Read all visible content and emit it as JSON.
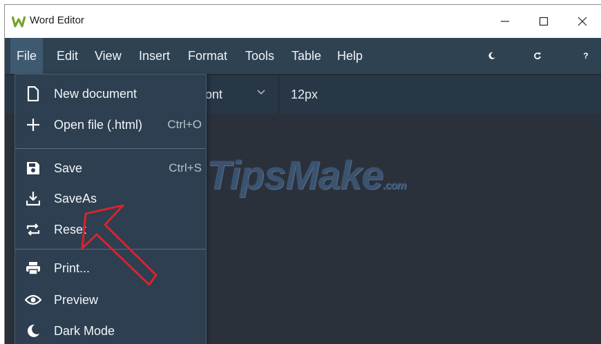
{
  "window": {
    "title": "Word Editor",
    "controls": [
      "minimize",
      "maximize",
      "close"
    ]
  },
  "menubar": {
    "items": [
      {
        "label": "File",
        "active": true
      },
      {
        "label": "Edit"
      },
      {
        "label": "View"
      },
      {
        "label": "Insert"
      },
      {
        "label": "Format"
      },
      {
        "label": "Tools"
      },
      {
        "label": "Table"
      },
      {
        "label": "Help"
      }
    ],
    "right_icons": [
      "moon-icon",
      "refresh-icon",
      "help-icon"
    ],
    "help_glyph": "?"
  },
  "toolbar": {
    "font_value": "Font",
    "font_partial_visible": "ont",
    "size_value": "12px"
  },
  "file_menu": {
    "items": [
      {
        "label": "New document",
        "icon": "file-icon"
      },
      {
        "label": "Open file (.html)",
        "shortcut": "Ctrl+O",
        "icon": "plus-icon"
      },
      {
        "label": "Save",
        "shortcut": "Ctrl+S",
        "icon": "save-icon"
      },
      {
        "label": "SaveAs",
        "icon": "download-icon"
      },
      {
        "label": "Reset",
        "icon": "repeat-icon"
      },
      {
        "label": "Print...",
        "icon": "printer-icon"
      },
      {
        "label": "Preview",
        "icon": "eye-icon"
      },
      {
        "label": "Dark Mode",
        "icon": "moon-icon"
      }
    ]
  },
  "watermark": {
    "text": "TipsMake",
    "suffix": ".com"
  },
  "colors": {
    "menubar_bg": "#2f4252",
    "dropdown_bg": "#2d3f50",
    "editor_bg": "#2b313b",
    "annotation_arrow": "#d9232e",
    "logo_green": "#7aa12e"
  }
}
